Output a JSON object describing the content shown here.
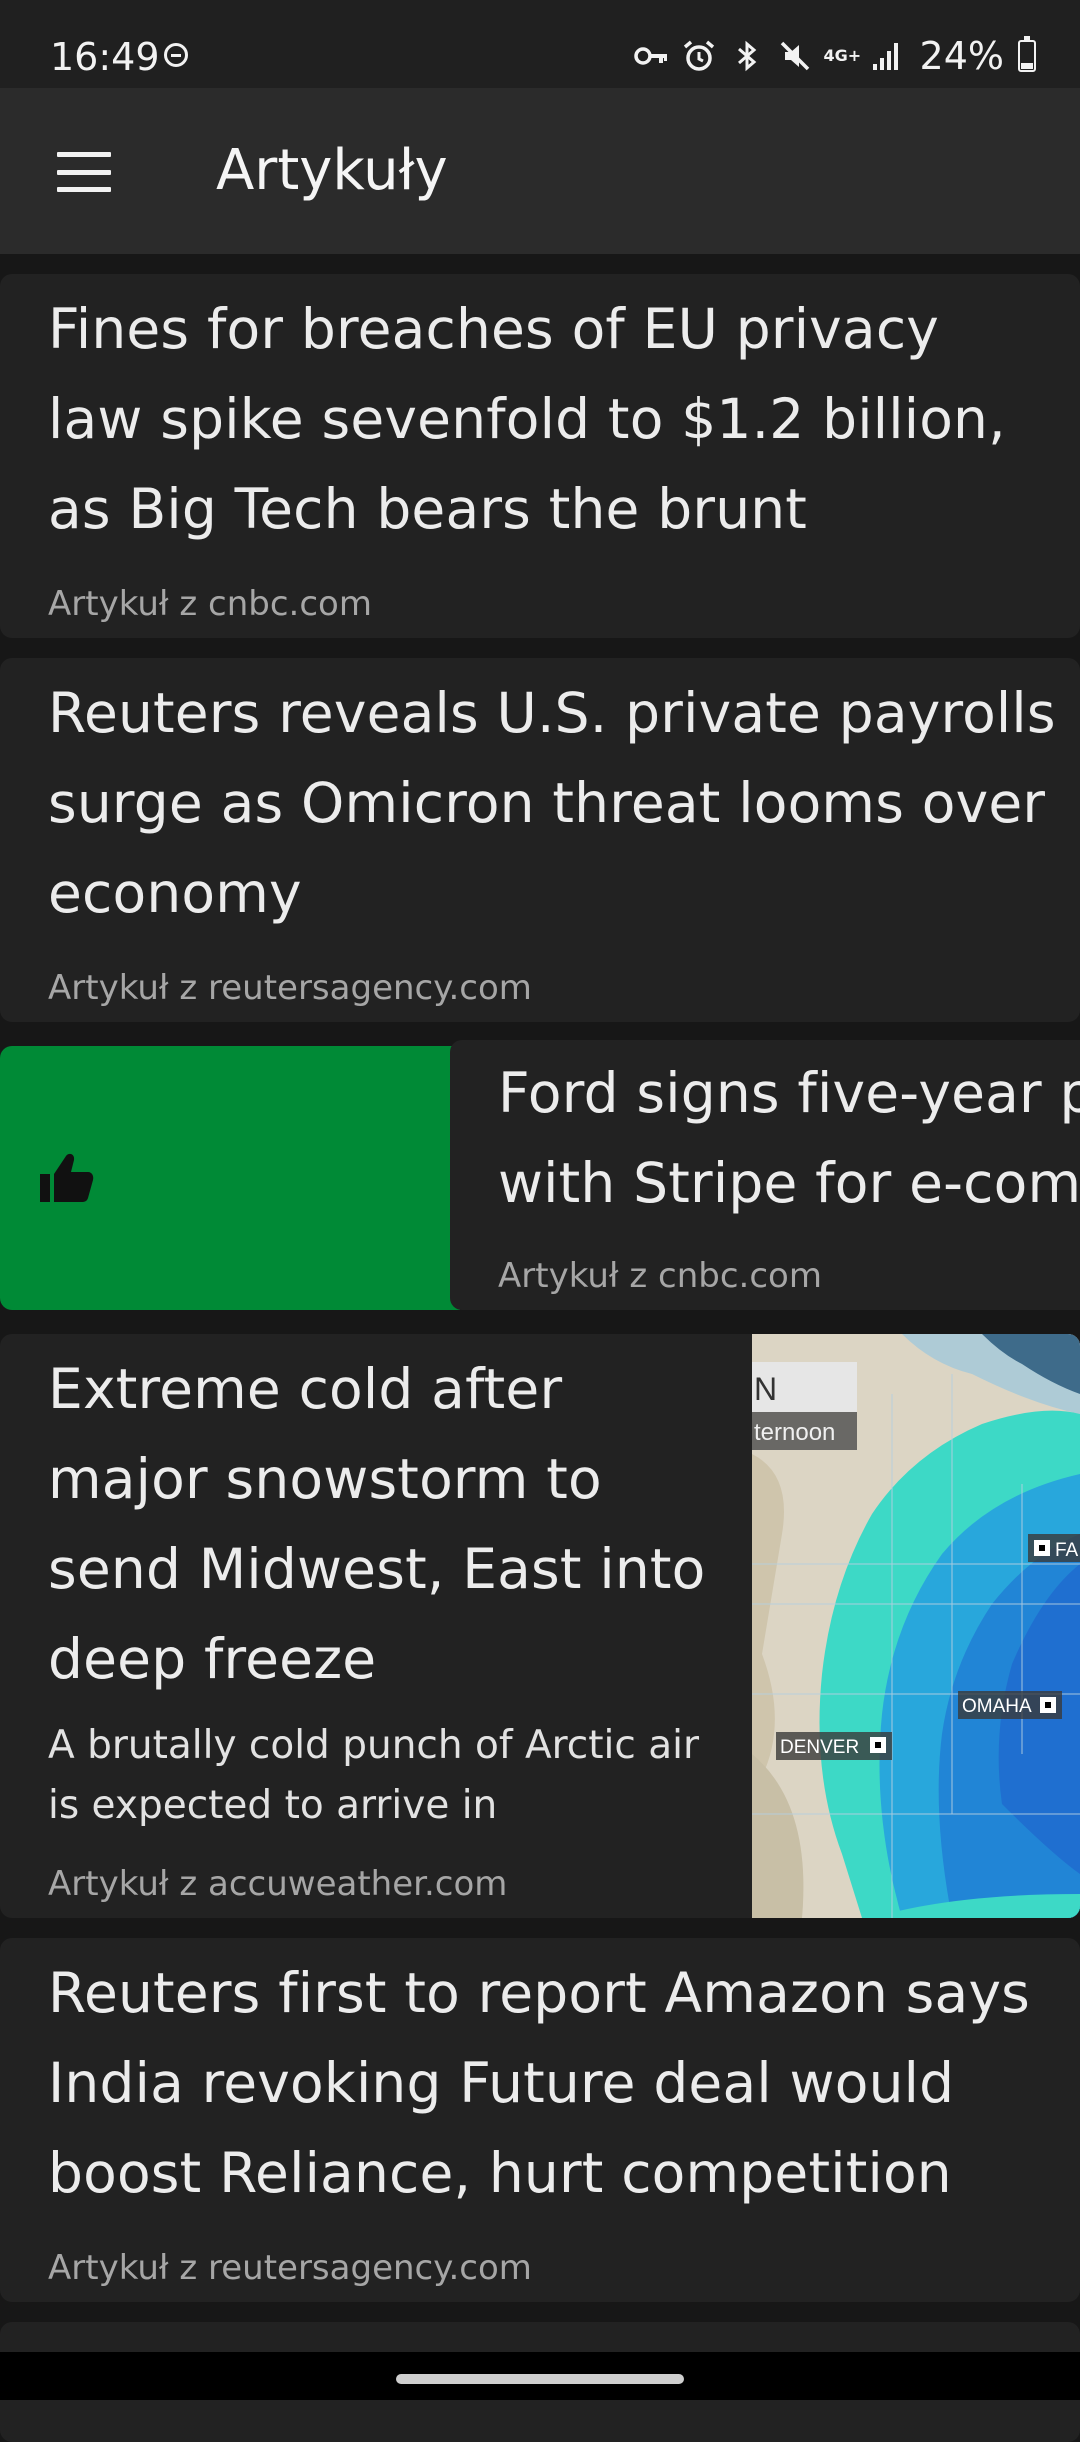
{
  "status_bar": {
    "time": "16:49",
    "network_label": "4G+",
    "battery": "24%",
    "battery_level": 0.24,
    "icons": [
      "do-not-disturb-icon",
      "vpn-key-icon",
      "alarm-icon",
      "bluetooth-icon",
      "mute-icon",
      "signal-icon",
      "battery-icon"
    ]
  },
  "app_bar": {
    "title": "Artykuły",
    "menu_icon": "hamburger-menu-icon"
  },
  "articles": [
    {
      "title": "Fines for breaches of EU privacy law spike sevenfold to $1.2 billion, as Big Tech bears the brunt",
      "source": "Artykuł z cnbc.com"
    },
    {
      "title": "Reuters reveals U.S. private payrolls surge as Omicron threat looms over economy",
      "source": "Artykuł z reutersagency.com"
    },
    {
      "title": "Ford signs five-year pa with Stripe for e-comm",
      "source": "Artykuł z cnbc.com",
      "swipe_action_icon": "thumbs-up-icon",
      "swipe_color": "#008a36"
    },
    {
      "title": "Extreme cold after major snowstorm to send Midwest, East into deep freeze",
      "summary": "A brutally cold punch of Arctic air is expected to arrive in",
      "source": "Artykuł z accuweather.com",
      "image": {
        "label_top": "N",
        "label_sub": "ternoon",
        "cities": [
          "FA",
          "OMAHA",
          "DENVER"
        ]
      }
    },
    {
      "title": "Reuters first to report Amazon says India revoking Future deal would boost Reliance, hurt competition",
      "source": "Artykuł z reutersagency.com"
    }
  ],
  "colors": {
    "background": "#171717",
    "card": "#222222",
    "app_bar": "#2b2b2b",
    "swipe_like": "#008a36"
  }
}
